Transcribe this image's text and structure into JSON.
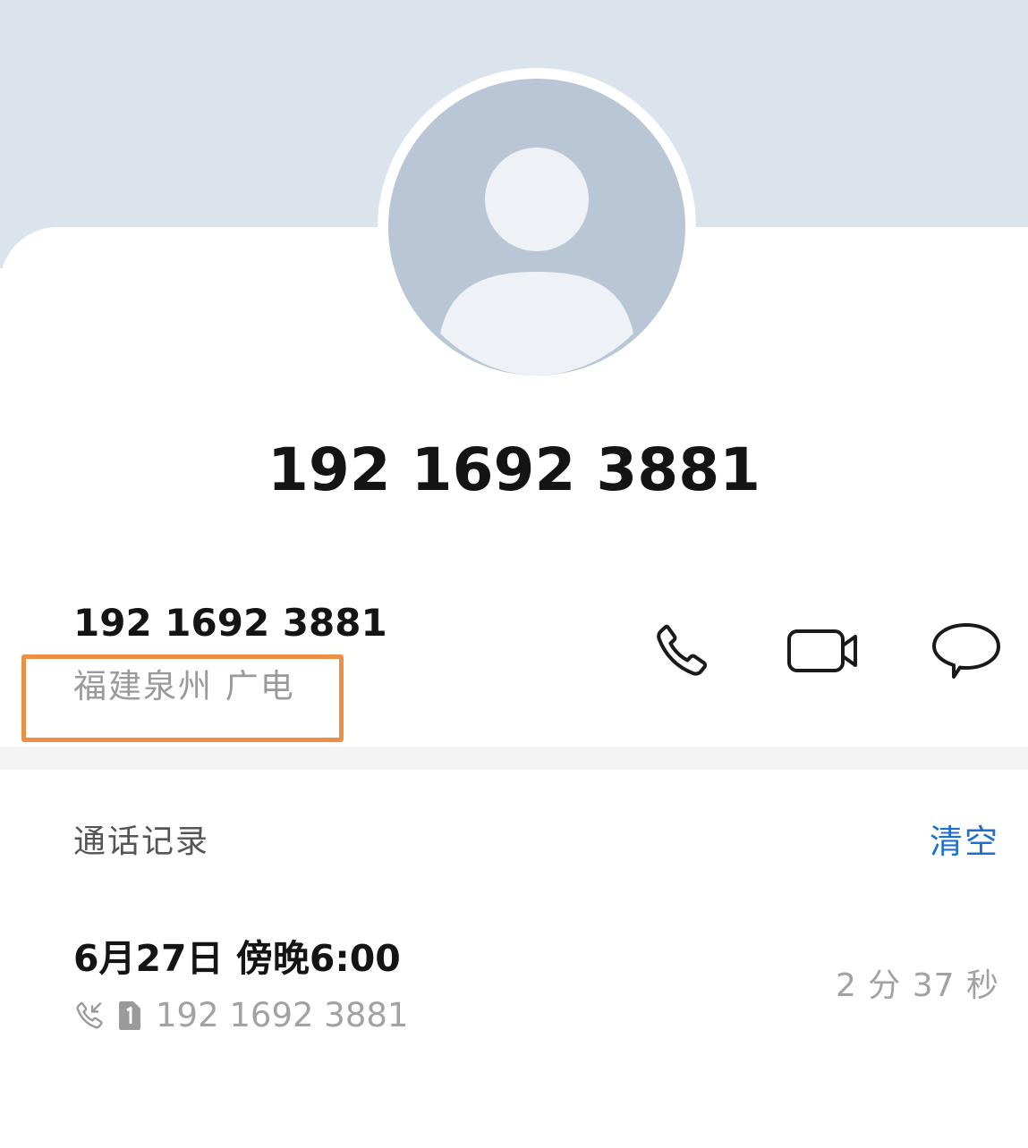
{
  "profile": {
    "display_number": "192 1692 3881"
  },
  "contact": {
    "number": "192 1692 3881",
    "location": "福建泉州 广电",
    "actions": {
      "call_icon": "phone-icon",
      "video_icon": "video-call-icon",
      "message_icon": "message-icon"
    }
  },
  "call_log": {
    "title": "通话记录",
    "clear_label": "清空",
    "records": [
      {
        "time": "6月27日 傍晚6:00",
        "number": "192 1692 3881",
        "duration": "2 分 37 秒",
        "type_icon": "incoming-call-icon",
        "sim_icon": "sim-1-icon"
      }
    ]
  },
  "colors": {
    "header_bg": "#dbe3ed",
    "avatar_bg": "#b8c6d5",
    "accent_blue": "#1f6fcf",
    "highlight_orange": "#ec8f46"
  }
}
